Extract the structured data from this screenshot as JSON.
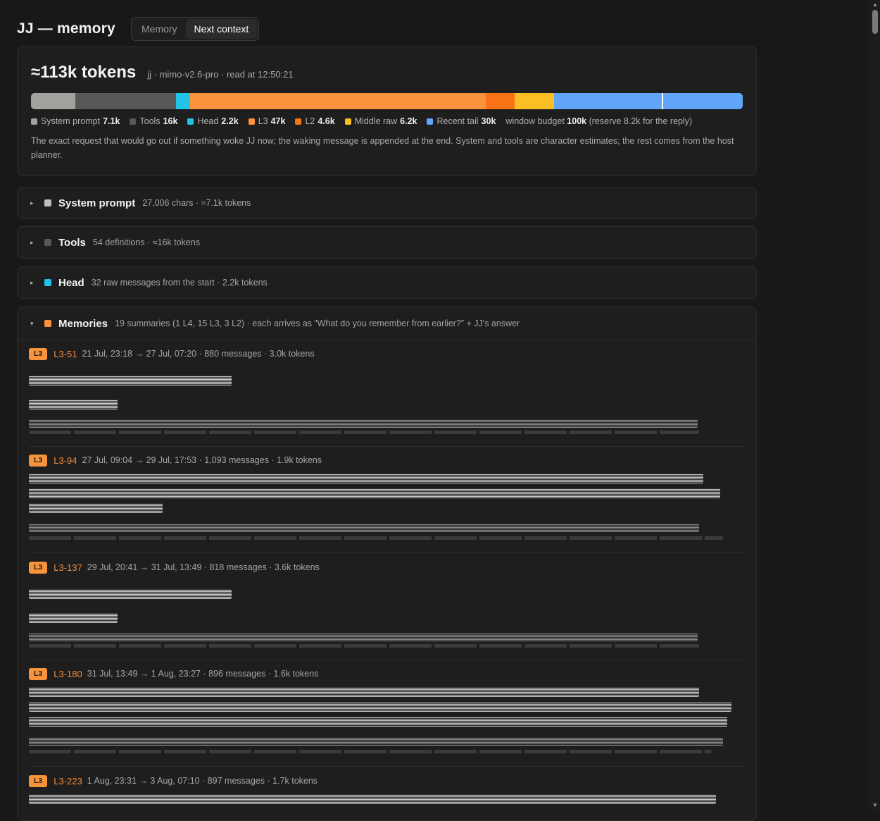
{
  "header": {
    "title": "JJ — memory",
    "tabs": [
      {
        "label": "Memory",
        "active": false
      },
      {
        "label": "Next context",
        "active": true
      }
    ]
  },
  "summary": {
    "total": "≈113k tokens",
    "meta": "jj · mimo-v2.6-pro · read at 12:50:21",
    "legend": [
      {
        "label": "System prompt",
        "value": "7.1k",
        "color": "#a3a19e"
      },
      {
        "label": "Tools",
        "value": "16k",
        "color": "#5a5856"
      },
      {
        "label": "Head",
        "value": "2.2k",
        "color": "#22c3e6"
      },
      {
        "label": "L3",
        "value": "47k",
        "color": "#fb923c"
      },
      {
        "label": "L2",
        "value": "4.6k",
        "color": "#f97316"
      },
      {
        "label": "Middle raw",
        "value": "6.2k",
        "color": "#fbbf24"
      },
      {
        "label": "Recent tail",
        "value": "30k",
        "color": "#60a5fa"
      }
    ],
    "budget_prefix": "window budget",
    "budget_value": "100k",
    "budget_suffix": "(reserve 8.2k for the reply)",
    "description": "The exact request that would go out if something woke JJ now; the waking message is appended at the end. System and tools are character estimates; the rest comes from the host planner."
  },
  "sections": [
    {
      "title": "System prompt",
      "meta": "27,006 chars · ≈7.1k tokens",
      "color": "#bdbdbd"
    },
    {
      "title": "Tools",
      "meta": "54 definitions · ≈16k tokens",
      "color": "#5a5856"
    },
    {
      "title": "Head",
      "meta": "32 raw messages from the start · 2.2k tokens",
      "color": "#22c3e6"
    }
  ],
  "memories": {
    "title": "Memories",
    "meta": "19 summaries (1 L4, 15 L3, 3 L2) · each arrives as “What do you remember from earlier?” + JJ's answer",
    "color": "#fb923c",
    "entries": [
      {
        "level": "L3",
        "id": "L3-51",
        "meta": "21 Jul, 23:18 → 27 Jul, 07:20 · 880 messages · 3.0k tokens"
      },
      {
        "level": "L3",
        "id": "L3-94",
        "meta": "27 Jul, 09:04 → 29 Jul, 17:53 · 1,093 messages · 1.9k tokens"
      },
      {
        "level": "L3",
        "id": "L3-137",
        "meta": "29 Jul, 20:41 → 31 Jul, 13:49 · 818 messages · 3.6k tokens"
      },
      {
        "level": "L3",
        "id": "L3-180",
        "meta": "31 Jul, 13:49 → 1 Aug, 23:27 · 896 messages · 1.6k tokens"
      },
      {
        "level": "L3",
        "id": "L3-223",
        "meta": "1 Aug, 23:31 → 3 Aug, 07:10 · 897 messages · 1.7k tokens"
      }
    ]
  }
}
